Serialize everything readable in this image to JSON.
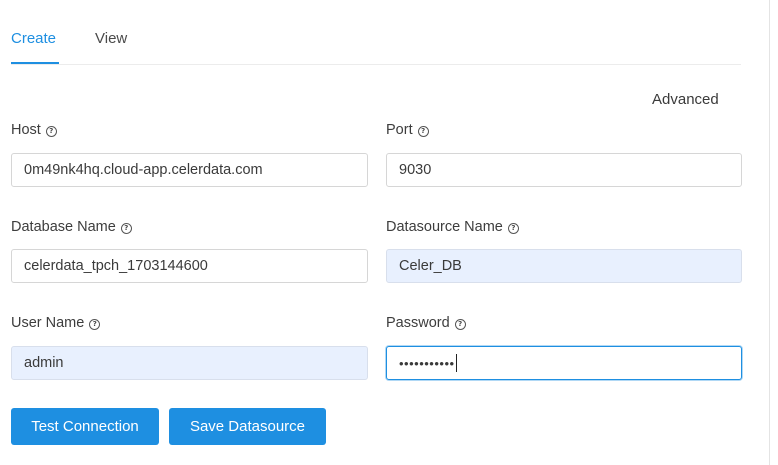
{
  "tabs": [
    {
      "label": "Create",
      "active": true
    },
    {
      "label": "View",
      "active": false
    }
  ],
  "advanced_label": "Advanced",
  "fields": {
    "host": {
      "label": "Host",
      "value": "0m49nk4hq.cloud-app.celerdata.com"
    },
    "port": {
      "label": "Port",
      "value": "9030"
    },
    "database_name": {
      "label": "Database Name",
      "value": "celerdata_tpch_1703144600"
    },
    "datasource_name": {
      "label": "Datasource Name",
      "value": "Celer_DB"
    },
    "user_name": {
      "label": "User Name",
      "value": "admin"
    },
    "password": {
      "label": "Password",
      "value": "•••••••••••"
    }
  },
  "help_glyph": "?",
  "buttons": {
    "test_connection": "Test Connection",
    "save_datasource": "Save Datasource"
  },
  "colors": {
    "accent": "#1e8fe1",
    "autofill_bg": "#e8f0fe"
  }
}
